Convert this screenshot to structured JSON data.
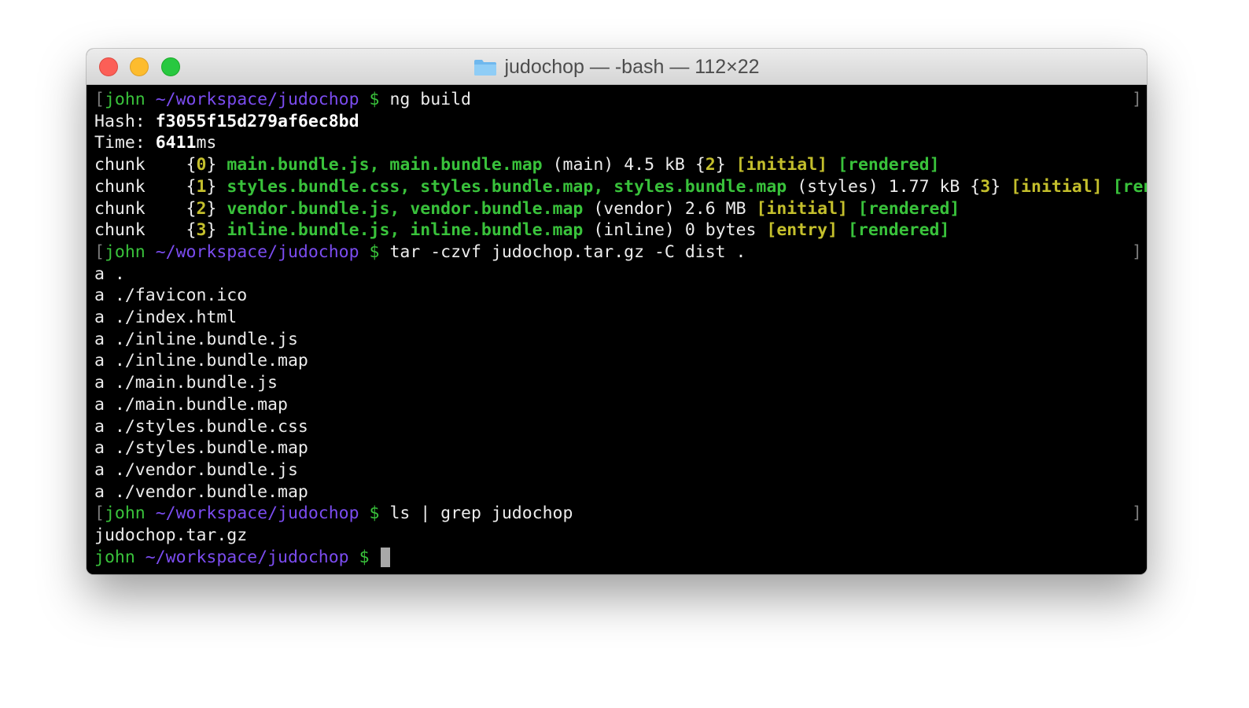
{
  "window": {
    "title": "judochop — -bash — 112×22"
  },
  "prompt": {
    "user": "john",
    "path": "~/workspace/judochop",
    "symbol": "$"
  },
  "commands": {
    "cmd1": "ng build",
    "cmd2": "tar -czvf judochop.tar.gz -C dist .",
    "cmd3": "ls | grep judochop"
  },
  "build_output": {
    "hash_label": "Hash:",
    "hash_value": "f3055f15d279af6ec8bd",
    "time_label": "Time:",
    "time_value": "6411",
    "time_unit": "ms",
    "chunks": [
      {
        "label": "chunk",
        "id": "0",
        "files": "main.bundle.js, main.bundle.map",
        "name": "(main)",
        "size": "4.5 kB",
        "parents": "{2}",
        "flags": [
          "[initial]",
          "[rendered]"
        ]
      },
      {
        "label": "chunk",
        "id": "1",
        "files": "styles.bundle.css, styles.bundle.map, styles.bundle.map",
        "name": "(styles)",
        "size": "1.77 kB",
        "parents": "{3}",
        "flags": [
          "[initial]",
          "[rendered]"
        ]
      },
      {
        "label": "chunk",
        "id": "2",
        "files": "vendor.bundle.js, vendor.bundle.map",
        "name": "(vendor)",
        "size": "2.6 MB",
        "parents": "",
        "flags": [
          "[initial]",
          "[rendered]"
        ]
      },
      {
        "label": "chunk",
        "id": "3",
        "files": "inline.bundle.js, inline.bundle.map",
        "name": "(inline)",
        "size": "0 bytes",
        "parents": "",
        "flags": [
          "[entry]",
          "[rendered]"
        ]
      }
    ]
  },
  "tar_output": [
    "a .",
    "a ./favicon.ico",
    "a ./index.html",
    "a ./inline.bundle.js",
    "a ./inline.bundle.map",
    "a ./main.bundle.js",
    "a ./main.bundle.map",
    "a ./styles.bundle.css",
    "a ./styles.bundle.map",
    "a ./vendor.bundle.js",
    "a ./vendor.bundle.map"
  ],
  "ls_output": "judochop.tar.gz",
  "colors": {
    "prompt_user": "#39c23b",
    "prompt_path": "#7b4cf0",
    "filename_green": "#39c23b",
    "flag_yellow": "#c4bf2c",
    "terminal_bg": "#000000"
  },
  "icons": {
    "title_folder": "folder-icon"
  }
}
